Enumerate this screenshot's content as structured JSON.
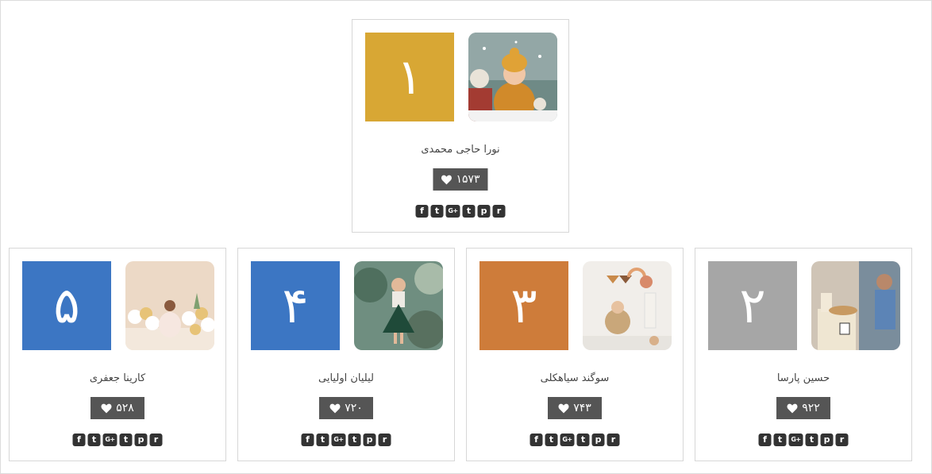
{
  "colors": {
    "gold": "#D8A734",
    "silver": "#A6A6A6",
    "bronze": "#CE7C3A",
    "blue": "#3C76C3",
    "like_bg": "#555555"
  },
  "social_icons": [
    "facebook-icon",
    "twitter-icon",
    "google-plus-icon",
    "tumblr-icon",
    "pinterest-icon",
    "reddit-icon"
  ],
  "cards": [
    {
      "rank": "۱",
      "name": "نورا حاجی محمدی",
      "likes": "۱۵۷۳",
      "rank_color": "gold"
    },
    {
      "rank": "۲",
      "name": "حسین پارسا",
      "likes": "۹۲۲",
      "rank_color": "silver"
    },
    {
      "rank": "۳",
      "name": "سوگند سیاهکلی",
      "likes": "۷۴۳",
      "rank_color": "bronze"
    },
    {
      "rank": "۴",
      "name": "لیلیان اولیایی",
      "likes": "۷۲۰",
      "rank_color": "blue"
    },
    {
      "rank": "۵",
      "name": "کارینا جعفری",
      "likes": "۵۲۸",
      "rank_color": "blue"
    }
  ]
}
